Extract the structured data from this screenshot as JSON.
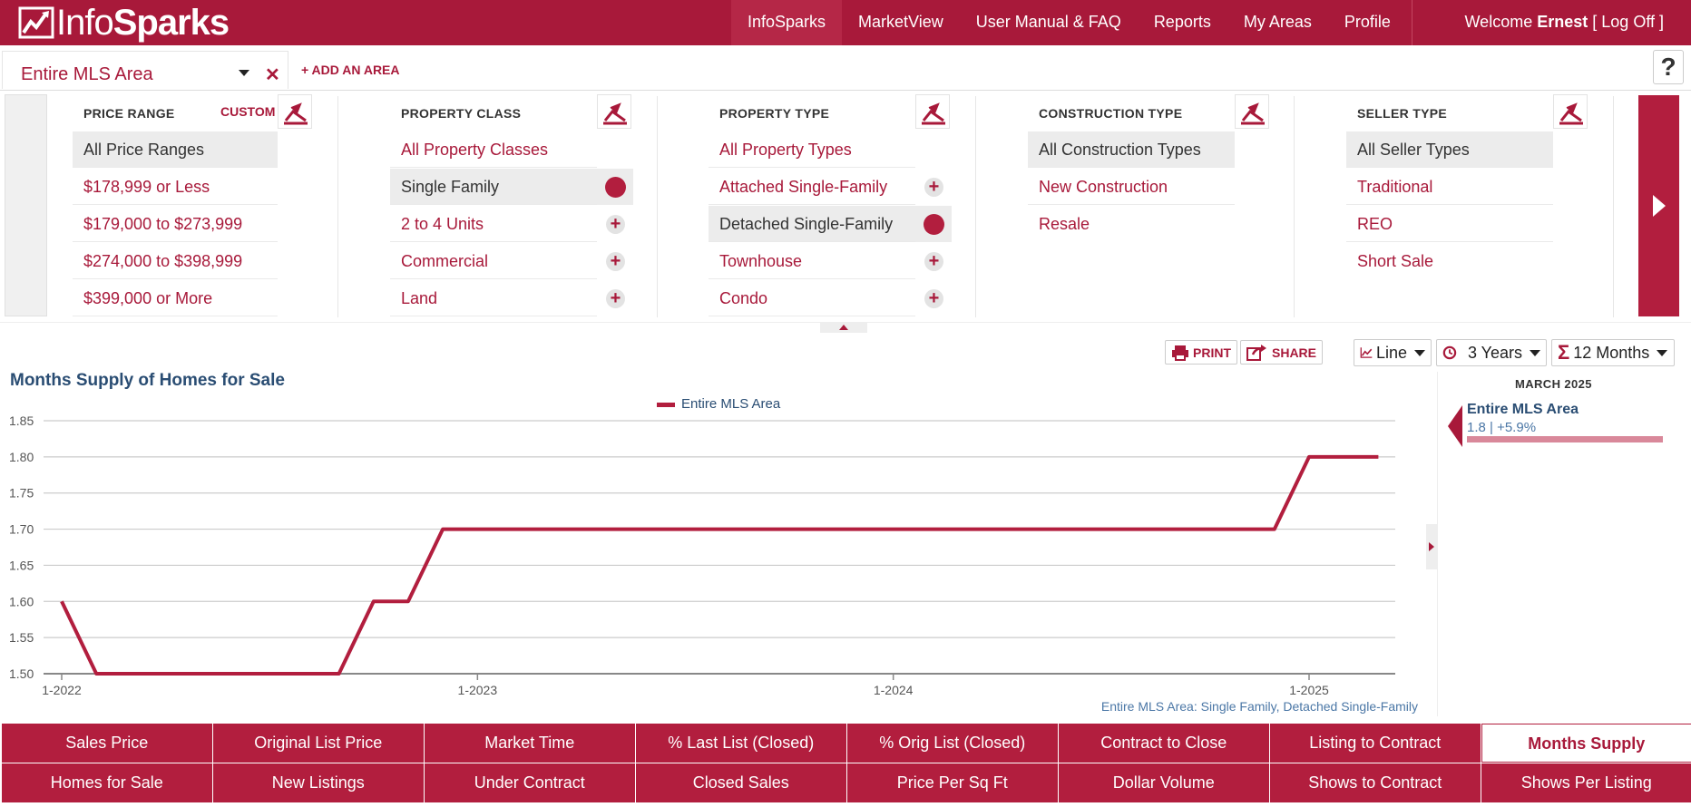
{
  "brand": {
    "logo_light": "Info",
    "logo_bold": "Sparks"
  },
  "nav": {
    "items": [
      "InfoSparks",
      "MarketView",
      "User Manual & FAQ",
      "Reports",
      "My Areas",
      "Profile"
    ],
    "welcome_prefix": "Welcome",
    "user": "Ernest",
    "logoff": "[ Log Off ]"
  },
  "area": {
    "selected": "Entire MLS Area",
    "add_label": "+ ADD AN AREA",
    "help": "?"
  },
  "filters": {
    "price": {
      "heading": "PRICE RANGE",
      "custom": "CUSTOM",
      "items": [
        "All Price Ranges",
        "$178,999 or Less",
        "$179,000 to $273,999",
        "$274,000 to $398,999",
        "$399,000 or More"
      ]
    },
    "property_class": {
      "heading": "PROPERTY CLASS",
      "items": [
        "All Property Classes",
        "Single Family",
        "2 to 4 Units",
        "Commercial",
        "Land"
      ]
    },
    "property_type": {
      "heading": "PROPERTY TYPE",
      "items": [
        "All Property Types",
        "Attached Single-Family",
        "Detached Single-Family",
        "Townhouse",
        "Condo"
      ]
    },
    "construction": {
      "heading": "CONSTRUCTION TYPE",
      "items": [
        "All Construction Types",
        "New Construction",
        "Resale"
      ]
    },
    "seller": {
      "heading": "SELLER TYPE",
      "items": [
        "All Seller Types",
        "Traditional",
        "REO",
        "Short Sale"
      ]
    }
  },
  "toolbar": {
    "print": "PRINT",
    "share": "SHARE",
    "chart_type": "Line",
    "range": "3 Years",
    "rolling": "12 Months"
  },
  "chart_data": {
    "type": "line",
    "title": "Months Supply of Homes for Sale",
    "legend": [
      "Entire MLS Area"
    ],
    "legend_position": "top-center",
    "ylim": [
      1.5,
      1.85
    ],
    "yticks": [
      "1.85",
      "1.80",
      "1.75",
      "1.70",
      "1.65",
      "1.60",
      "1.55",
      "1.50"
    ],
    "xticks": [
      "1-2022",
      "1-2023",
      "1-2024",
      "1-2025"
    ],
    "grid": true,
    "series": [
      {
        "name": "Entire MLS Area",
        "color": "#b21e3e",
        "x": [
          "2022-01",
          "2022-02",
          "2022-03",
          "2022-04",
          "2022-05",
          "2022-06",
          "2022-07",
          "2022-08",
          "2022-09",
          "2022-10",
          "2022-11",
          "2022-12",
          "2023-01",
          "2023-02",
          "2023-03",
          "2023-04",
          "2023-05",
          "2023-06",
          "2023-07",
          "2023-08",
          "2023-09",
          "2023-10",
          "2023-11",
          "2023-12",
          "2024-01",
          "2024-02",
          "2024-03",
          "2024-04",
          "2024-05",
          "2024-06",
          "2024-07",
          "2024-08",
          "2024-09",
          "2024-10",
          "2024-11",
          "2024-12",
          "2025-01",
          "2025-02",
          "2025-03"
        ],
        "values": [
          1.6,
          1.5,
          1.5,
          1.5,
          1.5,
          1.5,
          1.5,
          1.5,
          1.5,
          1.6,
          1.6,
          1.7,
          1.7,
          1.7,
          1.7,
          1.7,
          1.7,
          1.7,
          1.7,
          1.7,
          1.7,
          1.7,
          1.7,
          1.7,
          1.7,
          1.7,
          1.7,
          1.7,
          1.7,
          1.7,
          1.7,
          1.7,
          1.7,
          1.7,
          1.7,
          1.7,
          1.8,
          1.8,
          1.8
        ]
      }
    ],
    "note": "Entire MLS Area: Single Family, Detached Single-Family"
  },
  "side": {
    "month": "MARCH 2025",
    "area_name": "Entire MLS Area",
    "value": "1.8 | +5.9%"
  },
  "metrics": {
    "row1": [
      "Sales Price",
      "Original List Price",
      "Market Time",
      "% Last List (Closed)",
      "% Orig List (Closed)",
      "Contract to Close",
      "Listing to Contract",
      "Months Supply"
    ],
    "row2": [
      "Homes for Sale",
      "New Listings",
      "Under Contract",
      "Closed Sales",
      "Price Per Sq Ft",
      "Dollar Volume",
      "Shows to Contract",
      "Shows Per Listing"
    ]
  }
}
